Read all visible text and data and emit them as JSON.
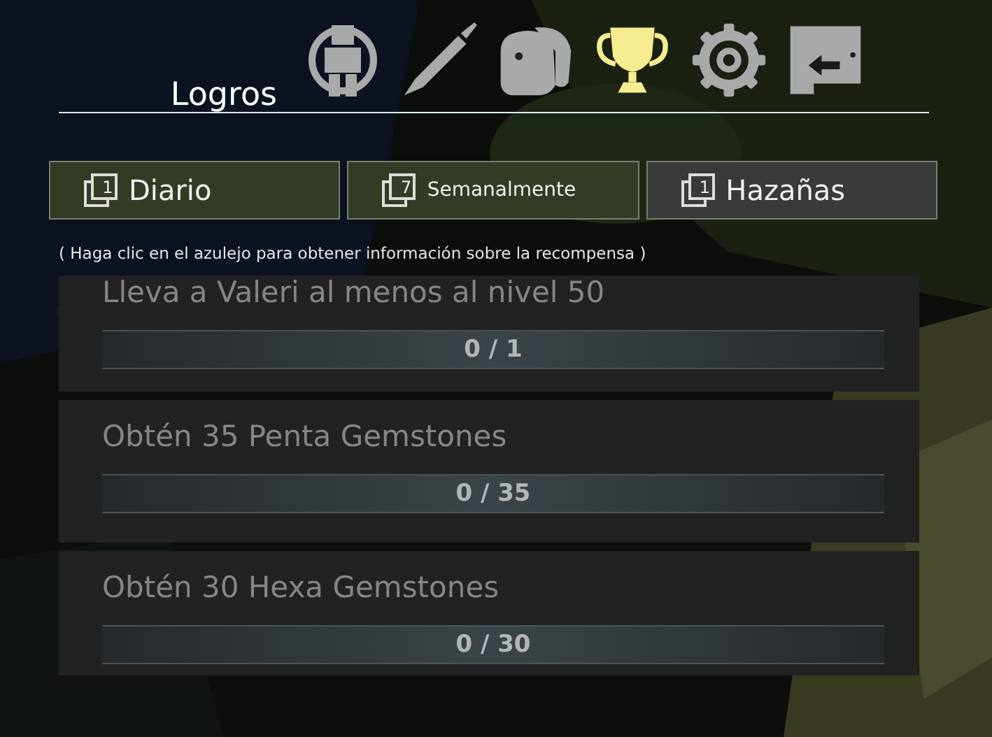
{
  "header": {
    "title": "Logros"
  },
  "nav_icons": [
    {
      "kind": "character",
      "selected": false
    },
    {
      "kind": "sword",
      "selected": false
    },
    {
      "kind": "bag",
      "selected": false
    },
    {
      "kind": "trophy",
      "selected": true
    },
    {
      "kind": "gear",
      "selected": false
    },
    {
      "kind": "exit",
      "selected": false
    }
  ],
  "tabs": [
    {
      "label": "Diario",
      "badge": "1",
      "selected": false
    },
    {
      "label": "Semanalmente",
      "badge": "7",
      "selected": false
    },
    {
      "label": "Hazañas",
      "badge": "1",
      "selected": true
    }
  ],
  "hint": "( Haga clic en el azulejo para obtener información sobre la recompensa )",
  "achievements": [
    {
      "title": "Lleva a Valeri al menos al nivel 50",
      "level": 0,
      "reading": "0 / 1"
    },
    {
      "title": "Obtén 35 Penta Gemstones",
      "level": 0,
      "reading": "0 / 35"
    },
    {
      "title": "Obtén 30 Hexa Gemstones",
      "level": 0,
      "reading": "0 / 30"
    }
  ]
}
